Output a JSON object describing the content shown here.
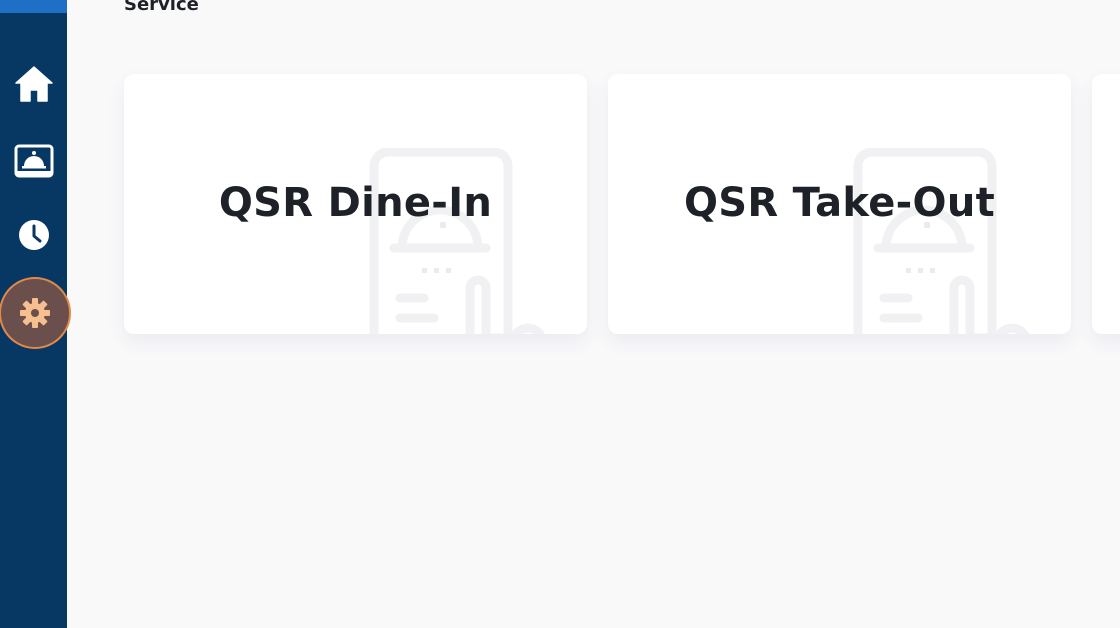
{
  "sidebar": {
    "items": [
      {
        "icon": "home-icon"
      },
      {
        "icon": "service-bell-icon"
      },
      {
        "icon": "clock-icon"
      },
      {
        "icon": "gear-icon",
        "active": true
      }
    ],
    "colors": {
      "background": "#073763",
      "accent": "#1f6fc6",
      "active_bg": "#6a4f4c",
      "active_ring": "#e08a4a",
      "active_icon": "#f6bf8f"
    }
  },
  "main": {
    "section_title": "Service",
    "cards": [
      {
        "label": "QSR Dine-In",
        "icon": "mobile-order-watermark-icon"
      },
      {
        "label": "QSR Take-Out",
        "icon": "mobile-order-watermark-icon"
      },
      {
        "label": ""
      }
    ]
  }
}
